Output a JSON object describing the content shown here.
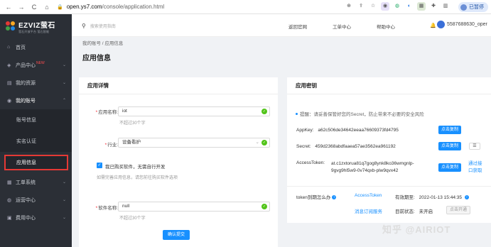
{
  "browser": {
    "back": "←",
    "forward": "→",
    "reload": "C",
    "home": "⌂",
    "url_host": "open.ys7.com",
    "url_path": "/console/application.html",
    "paused_label": "已暂停",
    "ext_icons": [
      "zoom-icon",
      "share-icon",
      "star-icon",
      "eye-icon",
      "paste-icon",
      "bookmark-icon",
      "camera-icon",
      "puzzle-icon",
      "sidebar-icon"
    ]
  },
  "logo": {
    "text": "EZVIZ萤石",
    "sub": "萤石开放平台 萤石智能"
  },
  "sidebar": {
    "items": [
      {
        "icon": "⌂",
        "label": "首页",
        "arrow": ""
      },
      {
        "icon": "◈",
        "label": "产品中心",
        "badge": "NEW",
        "arrow": "⌄"
      },
      {
        "icon": "▤",
        "label": "我的资源",
        "arrow": "⌄"
      },
      {
        "icon": "◉",
        "label": "我的账号",
        "arrow": "⌃"
      }
    ],
    "sub_items": [
      "账号信息",
      "实名认证",
      "应用信息"
    ],
    "items_after": [
      {
        "icon": "▦",
        "label": "工单系统",
        "arrow": "⌄"
      },
      {
        "icon": "◍",
        "label": "运营中心",
        "arrow": "⌄"
      },
      {
        "icon": "▣",
        "label": "费用中心",
        "arrow": "⌄"
      }
    ]
  },
  "topbar": {
    "search_placeholder": "搜索使用指南",
    "links": [
      "返回官网",
      "工单中心",
      "帮助中心"
    ],
    "user": "5587688630_oper"
  },
  "breadcrumb": "我的账号 /  应用信息",
  "page_title": "应用信息",
  "details": {
    "title": "应用详情",
    "app_name_label": "应用名称:",
    "app_name_value": "iot",
    "app_name_hint": "不超过30个字",
    "industry_label": "行业:",
    "industry_value": "设备看护",
    "bought_software_label": "我已购买软件，无需自行开发",
    "bought_hint": "如需完善应用信息，请您前往购买软件选项",
    "software_label": "软件名称:",
    "software_value": "null",
    "software_hint": "不超过30个字",
    "submit": "确认提交"
  },
  "keys": {
    "title": "应用密钥",
    "tip": "提醒：请妥善保管好您的Secret，防止带来不必要的安全风险",
    "appkey_label": "AppKey:",
    "appkey_value": "a62c506de34642eeaa76609373fd4795",
    "secret_label": "Secret:",
    "secret_value": "459d2368abdfaaea57ae3562ea961192",
    "token_label": "AccessToken:",
    "token_value_1": "at.c1zxtorua81q7gog8ynk8ko36wmgnlp-",
    "token_value_2": "9gvg9hl5w9-0v74qxb-plw9qvx42",
    "copy": "点击复制",
    "get_token_1": "通过接",
    "get_token_2": "口获取",
    "grid": "☰"
  },
  "token_status": {
    "question": "token到期怎么办",
    "access_token_link": "AccessToken",
    "expire_label": "有效期至:",
    "expire_value": "2022-01-13 15:44:35",
    "subscribe_link": "消息订阅服务",
    "status_label": "目前状态:",
    "status_value": "未开启",
    "open_button": "点击开通"
  },
  "watermark": "知乎 @AIRIOT"
}
